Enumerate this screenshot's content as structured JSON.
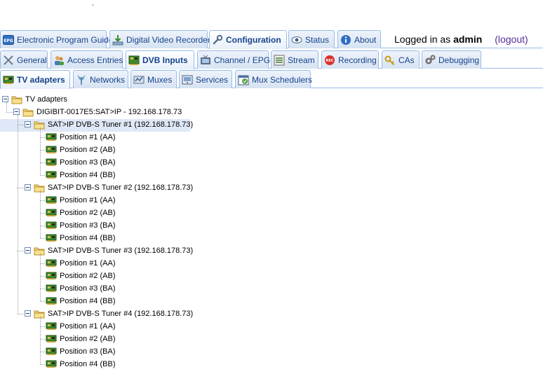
{
  "top_dot": ".",
  "main_tabs": [
    {
      "label": "Electronic Program Guide",
      "icon": "epg-icon",
      "active": false
    },
    {
      "label": "Digital Video Recorder",
      "icon": "dvr-download-icon",
      "active": false
    },
    {
      "label": "Configuration",
      "icon": "wrench-icon",
      "active": true
    },
    {
      "label": "Status",
      "icon": "eye-icon",
      "active": false
    },
    {
      "label": "About",
      "icon": "info-icon",
      "active": false
    }
  ],
  "login": {
    "prefix": "Logged in as",
    "user": "admin",
    "logout": "(logout)"
  },
  "config_tabs": [
    {
      "label": "General",
      "icon": "wrench-icon",
      "active": false
    },
    {
      "label": "Access Entries",
      "icon": "users-icon",
      "active": false
    },
    {
      "label": "DVB Inputs",
      "icon": "tv-card-icon",
      "active": true
    },
    {
      "label": "Channel / EPG",
      "icon": "tv-icon",
      "active": false
    },
    {
      "label": "Stream",
      "icon": "stream-icon",
      "active": false
    },
    {
      "label": "Recording",
      "icon": "rec-icon",
      "active": false
    },
    {
      "label": "CAs",
      "icon": "key-icon",
      "active": false
    },
    {
      "label": "Debugging",
      "icon": "gears-icon",
      "active": false
    }
  ],
  "dvb_tabs": [
    {
      "label": "TV adapters",
      "icon": "tv-card-icon",
      "active": true
    },
    {
      "label": "Networks",
      "icon": "antenna-icon",
      "active": false
    },
    {
      "label": "Muxes",
      "icon": "muxes-icon",
      "active": false
    },
    {
      "label": "Services",
      "icon": "services-icon",
      "active": false
    },
    {
      "label": "Mux Schedulers",
      "icon": "scheduler-icon",
      "active": false
    }
  ],
  "tree": {
    "root": "TV adapters",
    "device": "DIGIBIT-0017E5:SAT>IP - 192.168.178.73",
    "tuners": [
      {
        "label": "SAT>IP DVB-S Tuner #1 (192.168.178.73)",
        "selected": true,
        "positions": [
          "Position #1 (AA)",
          "Position #2 (AB)",
          "Position #3 (BA)",
          "Position #4 (BB)"
        ]
      },
      {
        "label": "SAT>IP DVB-S Tuner #2 (192.168.178.73)",
        "selected": false,
        "positions": [
          "Position #1 (AA)",
          "Position #2 (AB)",
          "Position #3 (BA)",
          "Position #4 (BB)"
        ]
      },
      {
        "label": "SAT>IP DVB-S Tuner #3 (192.168.178.73)",
        "selected": false,
        "positions": [
          "Position #1 (AA)",
          "Position #2 (AB)",
          "Position #3 (BA)",
          "Position #4 (BB)"
        ]
      },
      {
        "label": "SAT>IP DVB-S Tuner #4 (192.168.178.73)",
        "selected": false,
        "positions": [
          "Position #1 (AA)",
          "Position #2 (AB)",
          "Position #3 (BA)",
          "Position #4 (BB)"
        ]
      }
    ]
  }
}
